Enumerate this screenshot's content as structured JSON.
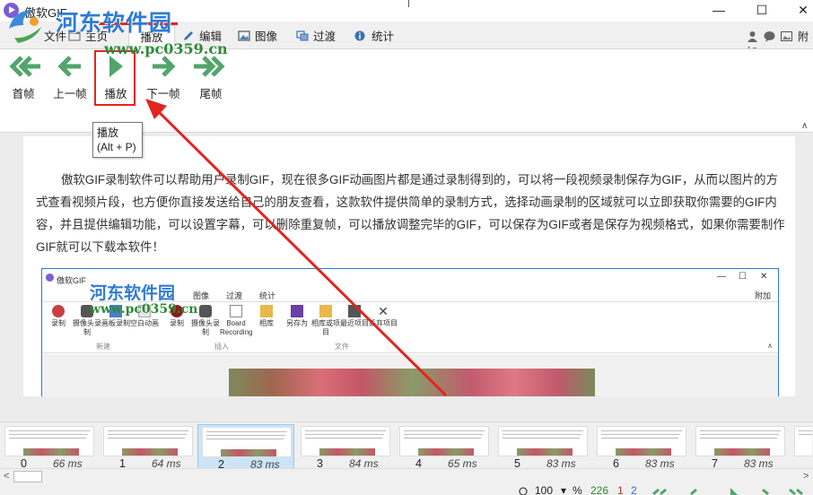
{
  "window": {
    "title": "傲软GIF",
    "minimize": "—",
    "maximize": "☐",
    "close": "✕"
  },
  "watermark": {
    "site_name": "河东软件园",
    "url": "www.pc0359.cn"
  },
  "tabs": [
    {
      "label": "文件",
      "icon": "file-icon"
    },
    {
      "label": "主页",
      "icon": "home-icon"
    },
    {
      "label": "播放",
      "icon": "play-tab-icon",
      "active": true
    },
    {
      "label": "编辑",
      "icon": "pencil-icon"
    },
    {
      "label": "图像",
      "icon": "image-icon"
    },
    {
      "label": "过渡",
      "icon": "transition-icon"
    },
    {
      "label": "统计",
      "icon": "info-icon"
    }
  ],
  "header_right": {
    "attach_label": "附加",
    "icons": [
      "user-icon",
      "chat-icon",
      "attach-icon"
    ]
  },
  "ribbon": {
    "buttons": [
      {
        "label": "首帧",
        "icon": "first-frame-icon"
      },
      {
        "label": "上一帧",
        "icon": "previous-frame-icon"
      },
      {
        "label": "播放",
        "icon": "play-icon"
      },
      {
        "label": "下一帧",
        "icon": "next-frame-icon"
      },
      {
        "label": "尾帧",
        "icon": "last-frame-icon"
      }
    ]
  },
  "tooltip": {
    "title": "播放",
    "shortcut": "(Alt + P)"
  },
  "article": {
    "text": "傲软GIF录制软件可以帮助用户录制GIF，现在很多GIF动画图片都是通过录制得到的，可以将一段视频录制保存为GIF，从而以图片的方式查看视频片段，也方便你直接发送给自己的朋友查看，这款软件提供简单的录制方式，选择动画录制的区域就可以立即获取你需要的GIF内容，并且提供编辑功能，可以设置字幕，可以删除重复帧，可以播放调整完毕的GIF，可以保存为GIF或者是保存为视频格式，如果你需要制作GIF就可以下载本软件！"
  },
  "embedded_screenshot": {
    "title": "傲软GIF",
    "tabs": [
      "图像",
      "过渡",
      "统计"
    ],
    "attach_label": "附加",
    "buttons": [
      {
        "label": "录制"
      },
      {
        "label": "摄像头录制"
      },
      {
        "label": "画板录制"
      },
      {
        "label": "空白动画"
      },
      {
        "label": "录制"
      },
      {
        "label": "摄像头录制"
      },
      {
        "label": "Board Recording"
      },
      {
        "label": "相库"
      },
      {
        "label": "另存为"
      },
      {
        "label": "相库或项目"
      },
      {
        "label": "最近项目"
      },
      {
        "label": "丢弃项目"
      }
    ],
    "groups": [
      "新建",
      "插入",
      "文件"
    ]
  },
  "frames": [
    {
      "index": "0",
      "delay": "66 ms"
    },
    {
      "index": "1",
      "delay": "64 ms"
    },
    {
      "index": "2",
      "delay": "83 ms",
      "selected": true
    },
    {
      "index": "3",
      "delay": "84 ms"
    },
    {
      "index": "4",
      "delay": "65 ms"
    },
    {
      "index": "5",
      "delay": "83 ms"
    },
    {
      "index": "6",
      "delay": "83 ms"
    },
    {
      "index": "7",
      "delay": "83 ms"
    }
  ],
  "scrollbar": {
    "left_arrow": "<",
    "right_arrow": ">"
  },
  "status": {
    "zoom_value": "100",
    "zoom_unit": "%",
    "frame_count": "226",
    "selected_count": "1",
    "current_frame": "2"
  },
  "colors": {
    "accent_red": "#e0261f",
    "nav_green": "#52a56a",
    "selection_blue": "#cce4f7",
    "watermark_blue": "#2f7bd2",
    "watermark_green": "#2c8b38"
  }
}
